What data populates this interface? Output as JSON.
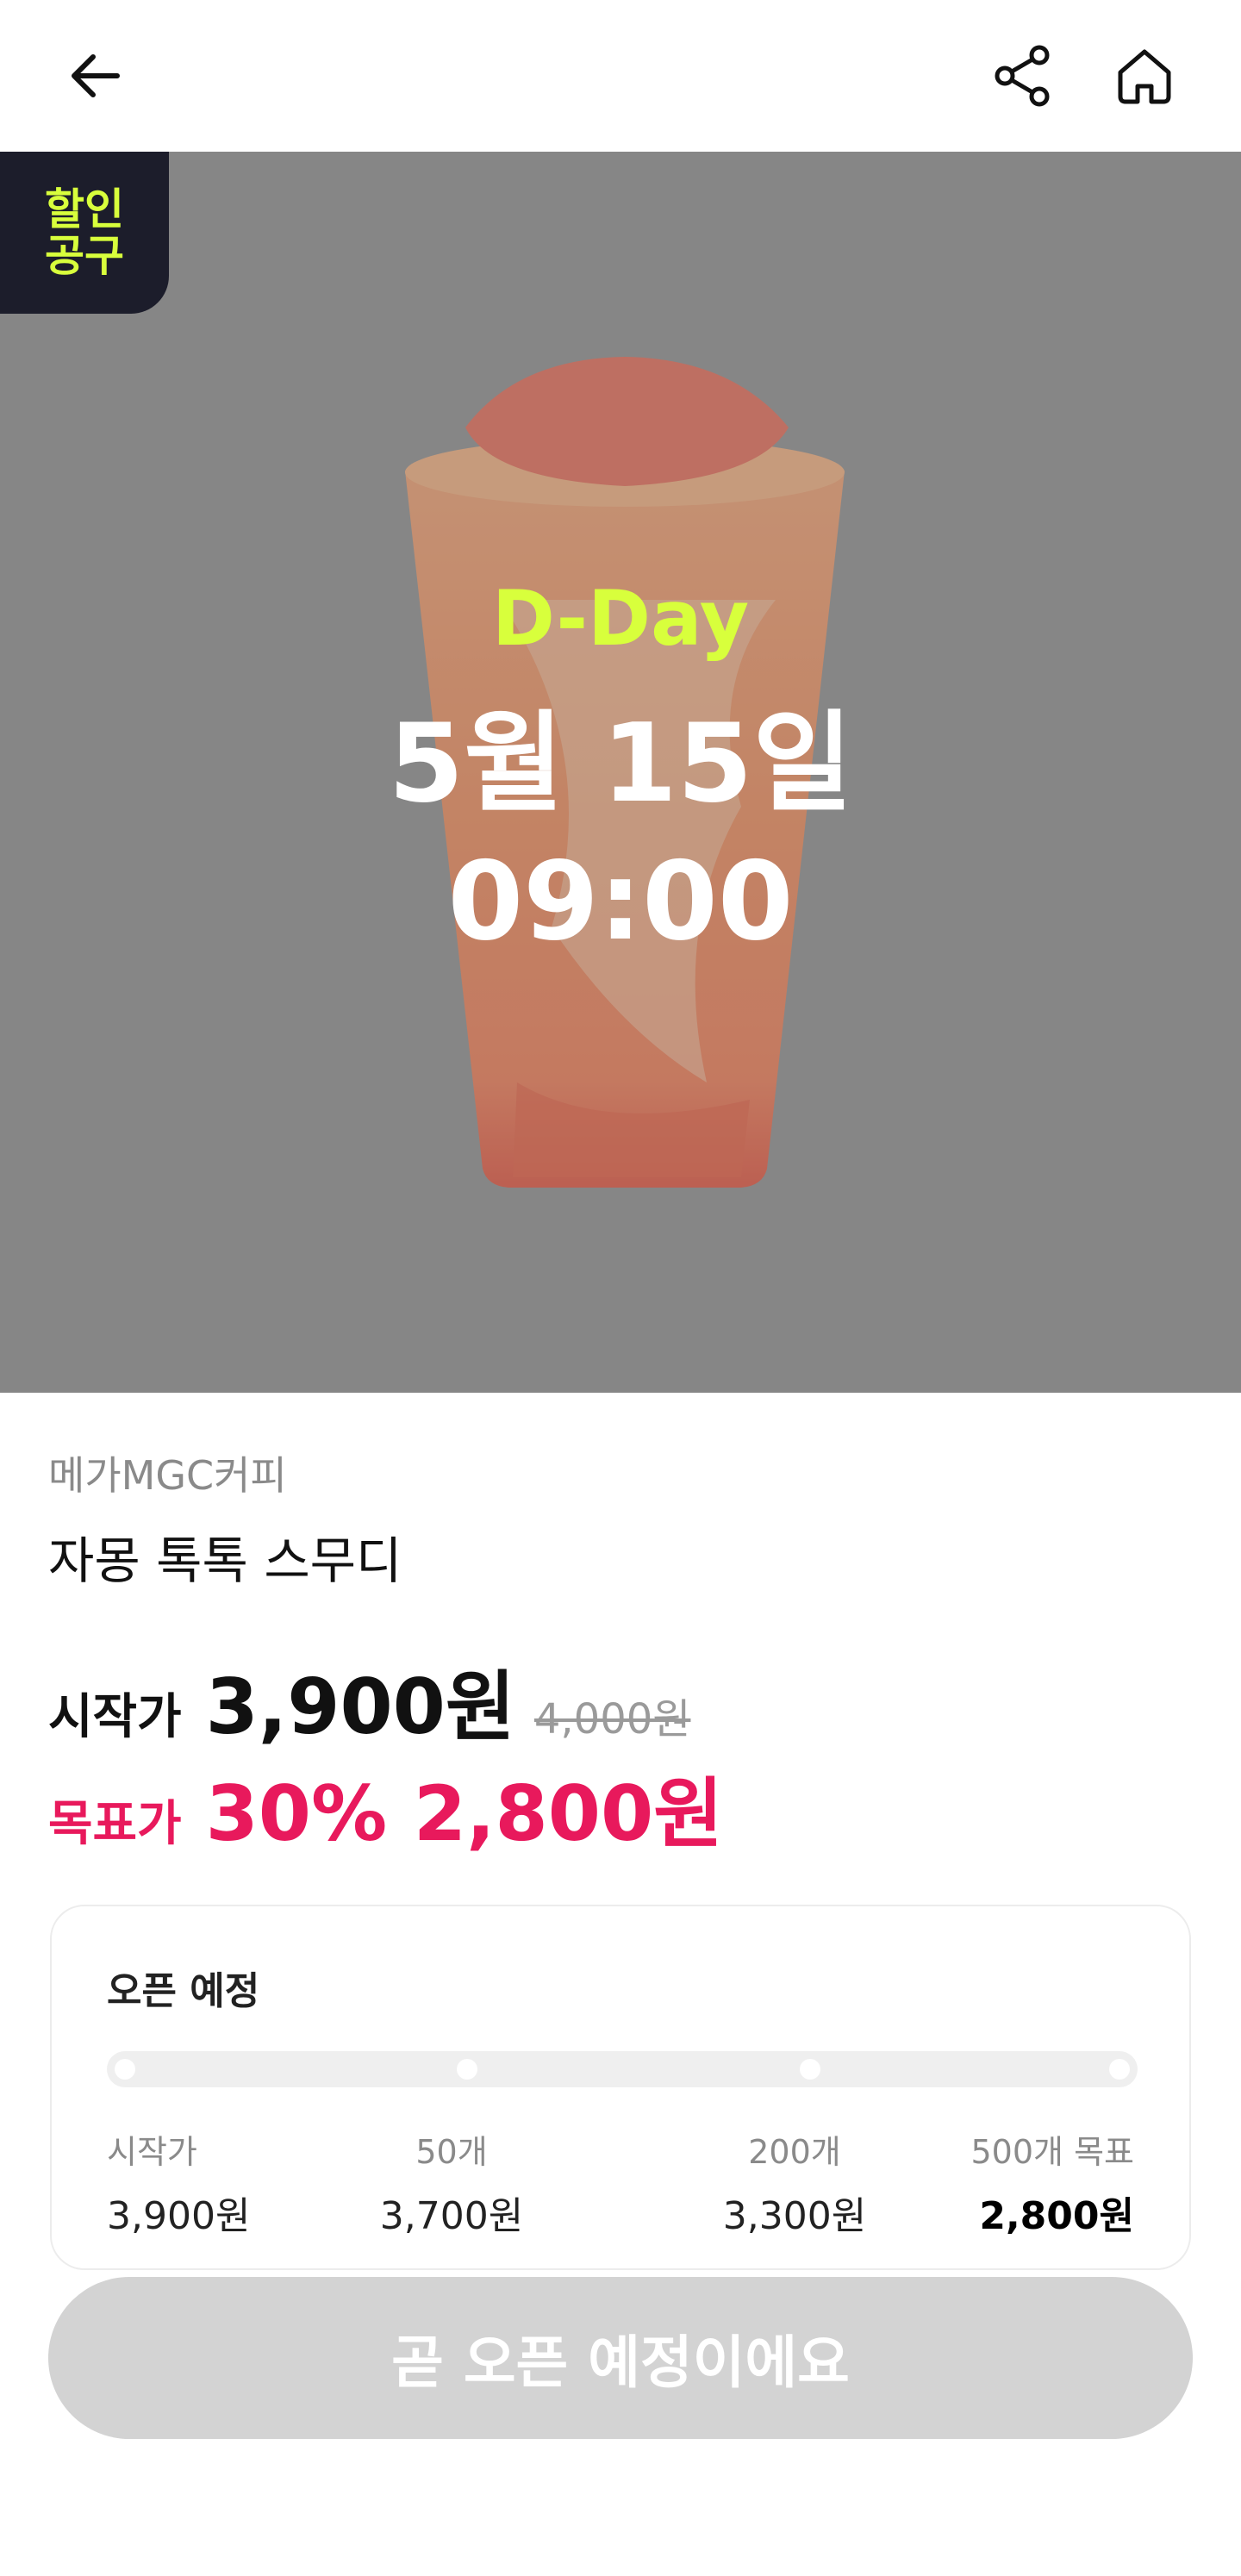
{
  "header": {
    "back_icon": "arrow-left-icon",
    "share_icon": "share-icon",
    "home_icon": "home-icon"
  },
  "hero": {
    "badge": "할인\n공구",
    "dday": "D-Day",
    "date": "5월 15일",
    "time": "09:00",
    "badge_color": "#d8ff3c"
  },
  "product": {
    "brand": "메가MGC커피",
    "name": "자몽 톡톡 스무디"
  },
  "pricing": {
    "start_label": "시작가",
    "start_price": "3,900원",
    "original_price": "4,000원",
    "target_label": "목표가",
    "target_price": "30% 2,800원",
    "accent_color": "#e8195c"
  },
  "tiers_card": {
    "title": "오픈 예정",
    "tiers": [
      {
        "qty": "시작가",
        "amount": "3,900원"
      },
      {
        "qty": "50개",
        "amount": "3,700원"
      },
      {
        "qty": "200개",
        "amount": "3,300원"
      },
      {
        "qty": "500개 목표",
        "amount": "2,800원"
      }
    ]
  },
  "cta": {
    "label": "곧 오픈 예정이에요"
  }
}
